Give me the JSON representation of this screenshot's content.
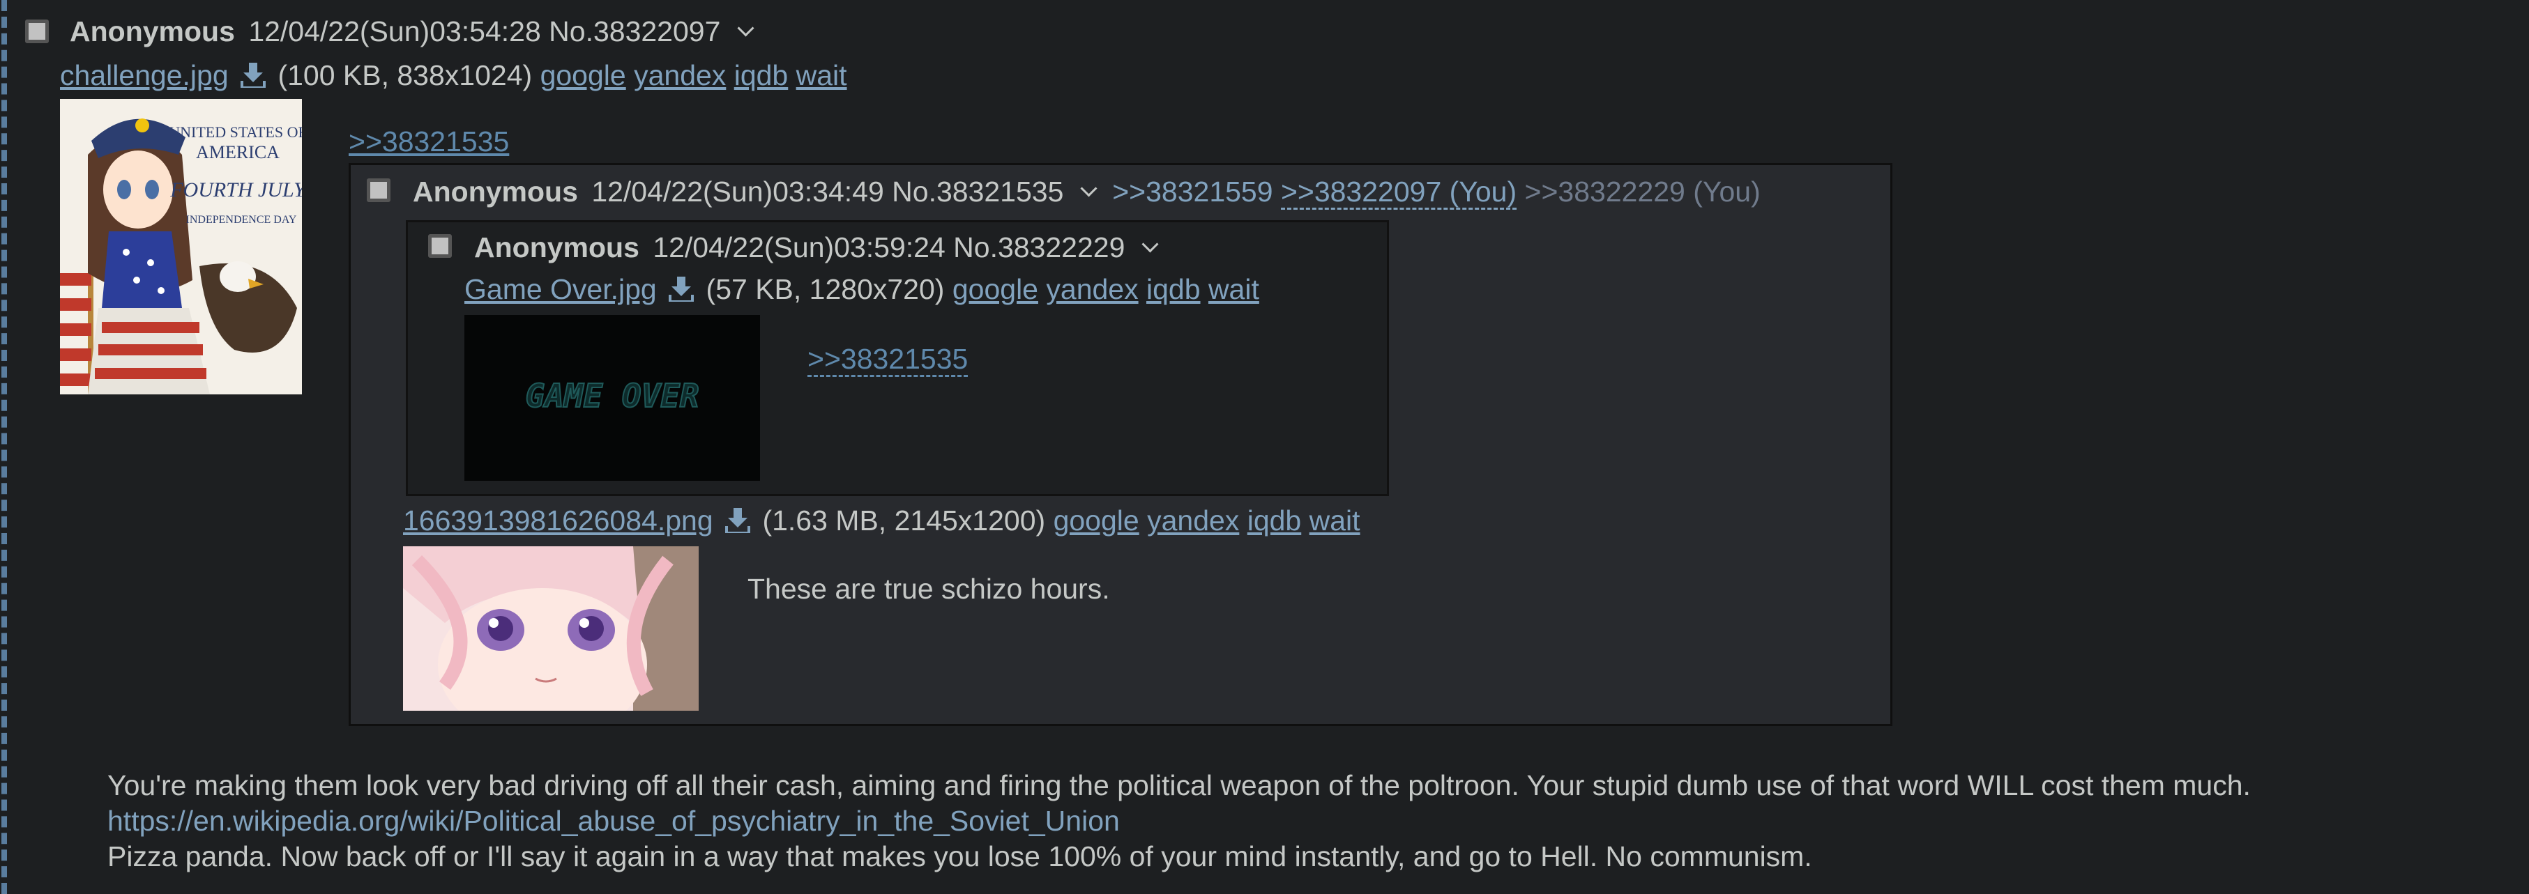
{
  "post_main": {
    "name": "Anonymous",
    "datetime": "12/04/22(Sun)03:54:28",
    "number": "No.38322097",
    "file": {
      "name": "challenge.jpg",
      "info": "(100 KB, 838x1024)",
      "search": [
        "google",
        "yandex",
        "iqdb",
        "wait"
      ]
    },
    "backquote": ">>38321535",
    "body_lines": [
      "You're making them look very bad driving off all their cash, aiming and firing the political weapon of the poltroon. Your stupid dumb use of that word WILL cost them much.",
      "https://en.wikipedia.org/wiki/Political_abuse_of_psychiatry_in_the_Soviet_Union",
      "Pizza panda. Now back off or I'll say it again in a way that makes you lose 100% of your mind instantly, and go to Hell. No communism."
    ]
  },
  "post_quoted": {
    "name": "Anonymous",
    "datetime": "12/04/22(Sun)03:34:49",
    "number": "No.38321535",
    "backlinks": [
      ">>38321559",
      ">>38322097 (You)",
      ">>38322229 (You)"
    ],
    "file": {
      "name": "1663913981626084.png",
      "info": "(1.63 MB, 2145x1200)",
      "search": [
        "google",
        "yandex",
        "iqdb",
        "wait"
      ]
    },
    "body": "These are true schizo hours."
  },
  "post_nested": {
    "name": "Anonymous",
    "datetime": "12/04/22(Sun)03:59:24",
    "number": "No.38322229",
    "file": {
      "name": "Game Over.jpg",
      "info": "(57 KB, 1280x720)",
      "search": [
        "google",
        "yandex",
        "iqdb",
        "wait"
      ]
    },
    "thumb_text": "GAME OVER",
    "quote": ">>38321535"
  },
  "thumb_main_text": [
    "UNITED STATES OF",
    "AMERICA",
    "FOURTH JULY",
    "INDEPENDENCE DAY"
  ],
  "icons": {
    "checkbox": "checkbox-icon",
    "menu": "chevron-down-icon",
    "download": "download-icon"
  },
  "colors": {
    "background": "#1d1f21",
    "reply_bg": "#282a2e",
    "text": "#c5c8c6",
    "link": "#81a2be",
    "quote_link": "#5f89ac"
  }
}
